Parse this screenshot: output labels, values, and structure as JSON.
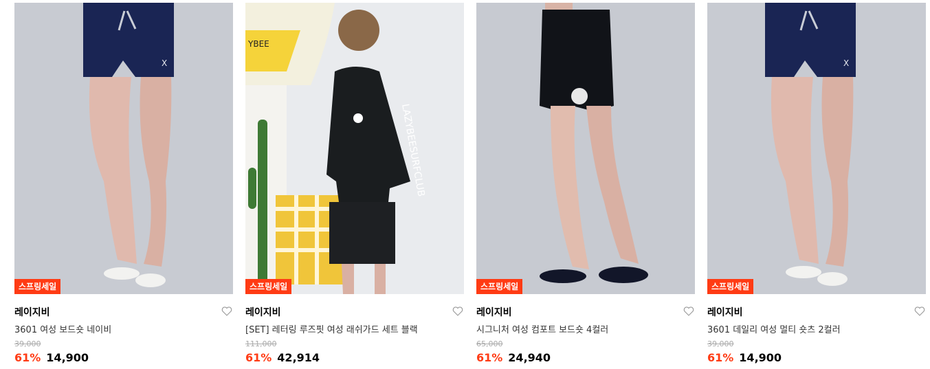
{
  "products": [
    {
      "badge": "스프링세일",
      "brand": "레이지비",
      "name": "3601 여성 보드숏 네이비",
      "original_price": "39,000",
      "discount": "61%",
      "price": "14,900",
      "wish_icon": "heart-outline-icon",
      "image": "model-legs-navy-shorts-white-flipflops"
    },
    {
      "badge": "스프링세일",
      "brand": "레이지비",
      "name": "[SET] 레터링 루즈핏 여성 래쉬가드 세트 블랙",
      "original_price": "111,000",
      "discount": "61%",
      "price": "42,914",
      "wish_icon": "heart-outline-icon",
      "image": "model-black-rashguard-set-umbrella-cactus",
      "image_text": "YBEE"
    },
    {
      "badge": "스프링세일",
      "brand": "레이지비",
      "name": "시그니처 여성 컴포트 보드숏 4컬러",
      "original_price": "65,000",
      "discount": "61%",
      "price": "24,940",
      "wish_icon": "heart-outline-icon",
      "image": "model-legs-black-shorts-navy-flipflops"
    },
    {
      "badge": "스프링세일",
      "brand": "레이지비",
      "name": "3601 데일리 여성 멀티 숏츠 2컬러",
      "original_price": "39,000",
      "discount": "61%",
      "price": "14,900",
      "wish_icon": "heart-outline-icon",
      "image": "model-legs-navy-shorts-white-flipflops"
    }
  ],
  "colors": {
    "accent": "#ff3b14",
    "photo_bg": "#c9ccd3"
  }
}
